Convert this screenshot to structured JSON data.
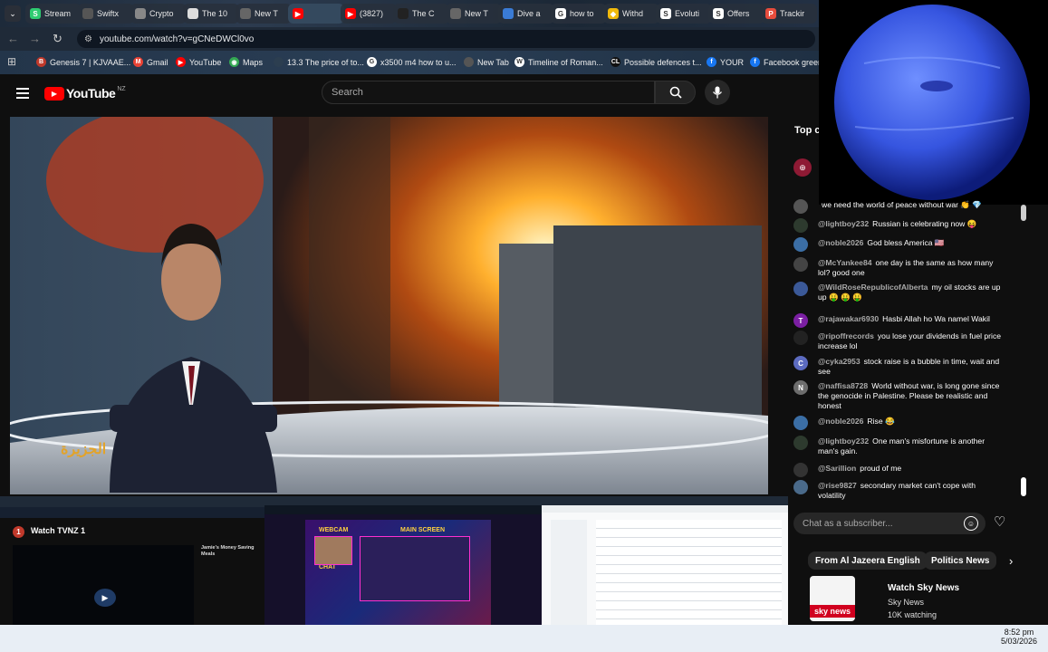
{
  "tabs": [
    {
      "label": "Stream",
      "fav_text": "S",
      "fav_color": "#2ecc71"
    },
    {
      "label": "Swiftx",
      "fav_text": "",
      "fav_color": "#555"
    },
    {
      "label": "Crypto",
      "fav_text": "",
      "fav_color": "#888"
    },
    {
      "label": "The 10",
      "fav_text": "",
      "fav_color": "#ddd"
    },
    {
      "label": "New T",
      "fav_text": "",
      "fav_color": "#666"
    },
    {
      "label": "",
      "fav_text": "▶",
      "fav_color": "#ff0000",
      "active": true
    },
    {
      "label": "(3827)",
      "fav_text": "▶",
      "fav_color": "#ff0000"
    },
    {
      "label": "The C",
      "fav_text": "",
      "fav_color": "#222"
    },
    {
      "label": "New T",
      "fav_text": "",
      "fav_color": "#666"
    },
    {
      "label": "Dive a",
      "fav_text": "",
      "fav_color": "#3a7bd5"
    },
    {
      "label": "how to",
      "fav_text": "G",
      "fav_color": "#fff"
    },
    {
      "label": "Withd",
      "fav_text": "◆",
      "fav_color": "#f0b90b"
    },
    {
      "label": "Evoluti",
      "fav_text": "S",
      "fav_color": "#fff"
    },
    {
      "label": "Offers",
      "fav_text": "S",
      "fav_color": "#fff"
    },
    {
      "label": "Trackir",
      "fav_text": "P",
      "fav_color": "#e74c3c"
    }
  ],
  "address": {
    "url": "youtube.com/watch?v=gCNeDWCl0vo"
  },
  "bookmarks": [
    {
      "label": "Genesis 7 | KJVAAE...",
      "icon_color": "#c0392b",
      "icon_text": "B"
    },
    {
      "label": "Gmail",
      "icon_color": "#ea4335",
      "icon_text": "M"
    },
    {
      "label": "YouTube",
      "icon_color": "#ff0000",
      "icon_text": "▶"
    },
    {
      "label": "Maps",
      "icon_color": "#34a853",
      "icon_text": "◉"
    },
    {
      "label": "13.3 The price of to...",
      "icon_color": "#2c3e50",
      "icon_text": ""
    },
    {
      "label": "x3500 m4 how to u...",
      "icon_color": "#fff",
      "icon_text": "G"
    },
    {
      "label": "New Tab",
      "icon_color": "#555",
      "icon_text": ""
    },
    {
      "label": "Timeline of Roman...",
      "icon_color": "#fff",
      "icon_text": "W"
    },
    {
      "label": "Possible defences t...",
      "icon_color": "#111",
      "icon_text": "CL"
    },
    {
      "label": "YOUR",
      "icon_color": "#1877f2",
      "icon_text": "f"
    },
    {
      "label": "Facebook green",
      "icon_color": "#1877f2",
      "icon_text": "f"
    }
  ],
  "youtube": {
    "logo": "YouTube",
    "region": "NZ",
    "search_placeholder": "Search"
  },
  "video": {
    "channel_bug": "الجزيرة"
  },
  "thumbnails": [
    {
      "title": "Watch TVNZ 1",
      "side_title": "Jamie's Money Saving Meals"
    },
    {
      "webcam": "WEBCAM",
      "main": "MAIN SCREEN",
      "chat": "CHAT"
    },
    {}
  ],
  "chat": {
    "header": "Top c",
    "messages": [
      {
        "author": "",
        "text": "we need the world of peace without war 👏 💎",
        "avatar_color": "#555",
        "avatar_text": ""
      },
      {
        "author": "@lightboy232",
        "text": "Russian is celebrating now 😝",
        "avatar_color": "#2d3a2e",
        "avatar_text": ""
      },
      {
        "author": "@noble2026",
        "text": "God bless America 🇺🇸",
        "avatar_color": "#3b6ea5",
        "avatar_text": ""
      },
      {
        "author": "@McYankee84",
        "text": "one day is the same as how many lol? good one",
        "avatar_color": "#444",
        "avatar_text": ""
      },
      {
        "author": "@WildRoseRepublicofAlberta",
        "text": "my oil stocks are up up 🤑 🤑 🤑",
        "avatar_color": "#3b5998",
        "avatar_text": ""
      },
      {
        "author": "@rajawakar6930",
        "text": "Hasbi Allah ho Wa namel Wakil",
        "avatar_color": "#7b1fa2",
        "avatar_text": "T"
      },
      {
        "author": "@ripoffrecords",
        "text": "you lose your dividends in fuel price increase lol",
        "avatar_color": "#222",
        "avatar_text": ""
      },
      {
        "author": "@cyka2953",
        "text": "stock raise is a bubble in time, wait and see",
        "avatar_color": "#5c6bc0",
        "avatar_text": "C"
      },
      {
        "author": "@naffisa8728",
        "text": "World without war, is long gone since the genocide in Palestine. Please be realistic and honest",
        "avatar_color": "#6d6d6d",
        "avatar_text": "N"
      },
      {
        "author": "@noble2026",
        "text": "Rise 😂",
        "avatar_color": "#3b6ea5",
        "avatar_text": ""
      },
      {
        "author": "@lightboy232",
        "text": "One man's misfortune is another man's gain.",
        "avatar_color": "#2d3a2e",
        "avatar_text": ""
      },
      {
        "author": "@Sarillion",
        "text": "proud of me",
        "avatar_color": "#333",
        "avatar_text": ""
      },
      {
        "author": "@rise9827",
        "text": "secondary market can't cope with volatility",
        "avatar_color": "#4a6a8a",
        "avatar_text": ""
      }
    ],
    "input_placeholder": "Chat as a subscriber...",
    "chips": [
      "From Al Jazeera English",
      "Politics News"
    ],
    "rec_title": "Watch Sky News",
    "rec_channel": "Sky News",
    "rec_meta": "10K watching",
    "rec_logo": "sky news"
  },
  "taskbar": {
    "time": "8:52 pm",
    "date": "5/03/2026"
  }
}
